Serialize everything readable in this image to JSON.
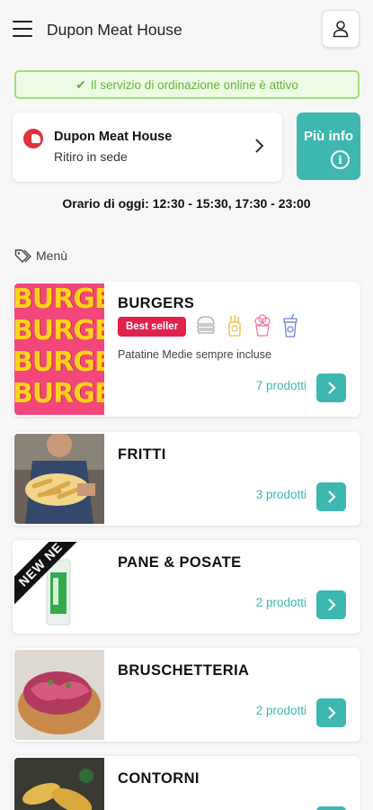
{
  "header": {
    "title": "Dupon Meat House",
    "menu_icon": "hamburger-icon",
    "user_icon": "user-icon"
  },
  "banner": {
    "text": "Il servizio di ordinazione online è attivo",
    "icon": "check-icon",
    "color": "#62b63a"
  },
  "restaurant": {
    "name": "Dupon Meat House",
    "mode": "Ritiro in sede"
  },
  "info_button": {
    "label": "Più info",
    "icon": "info-icon"
  },
  "hours": "Orario di oggi: 12:30 - 15:30, 17:30 - 23:00",
  "menu_section": {
    "label": "Menù",
    "icon": "tag-icon"
  },
  "categories": [
    {
      "title": "BURGERS",
      "badge": "Best seller",
      "description": "Patatine Medie sempre incluse",
      "count": "7 prodotti",
      "thumb_text": "BURGERS"
    },
    {
      "title": "FRITTI",
      "count": "3 prodotti"
    },
    {
      "title": "PANE & POSATE",
      "count": "2 prodotti",
      "ribbon": "NEW NE"
    },
    {
      "title": "BRUSCHETTERIA",
      "count": "2 prodotti"
    },
    {
      "title": "CONTORNI"
    }
  ],
  "colors": {
    "accent": "#3eb7b1",
    "badge": "#e0214e",
    "banner_border": "#9ddf7b"
  }
}
